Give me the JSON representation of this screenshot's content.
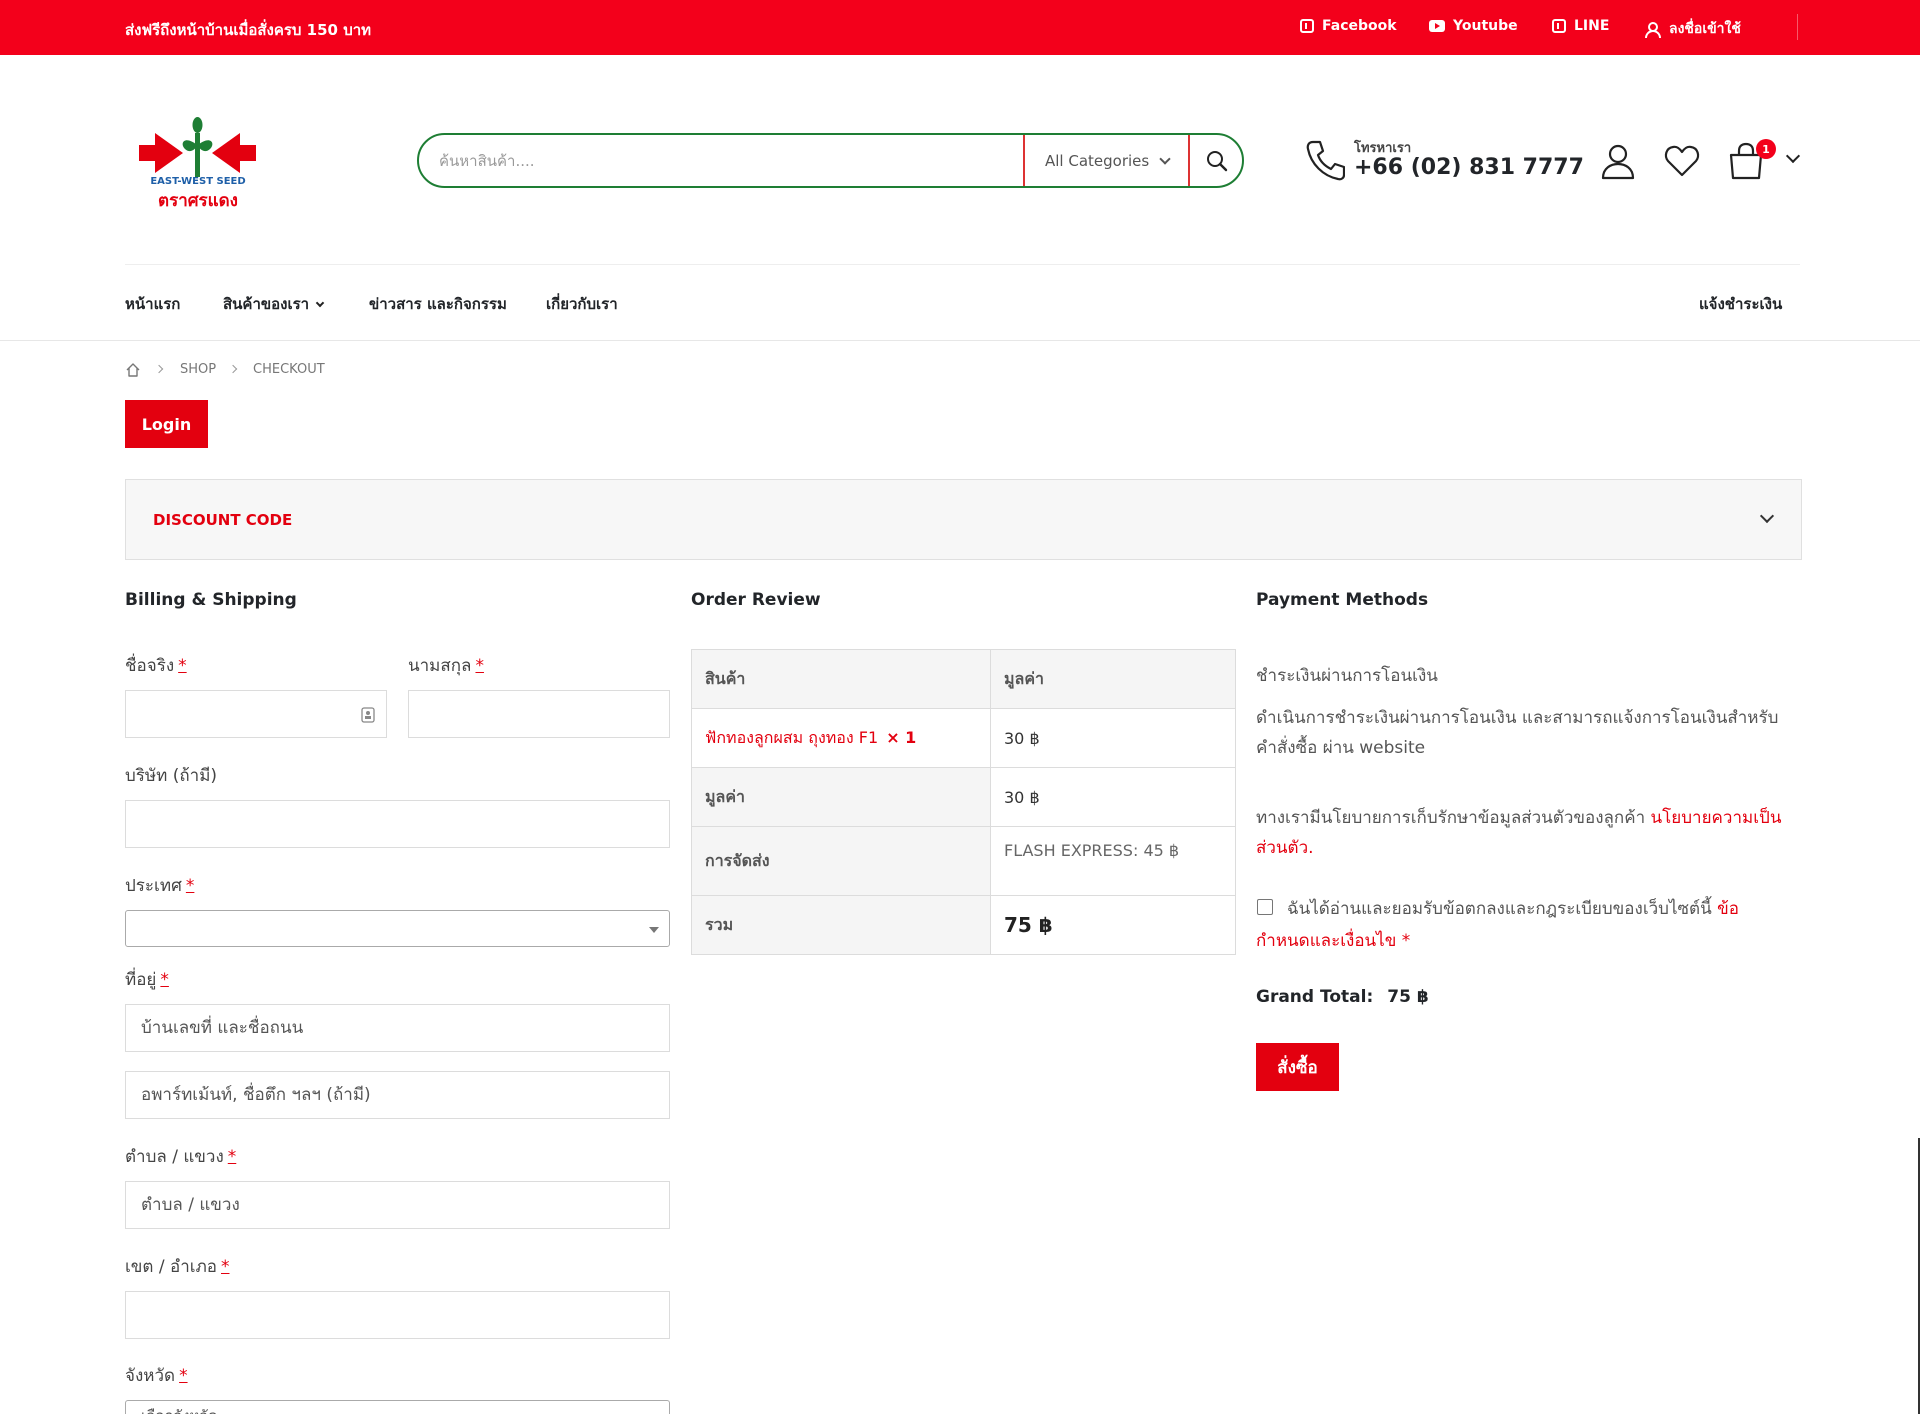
{
  "topbar": {
    "promo": "ส่งฟรีถึงหน้าบ้านเมื่อสั่งครบ 150 บาท",
    "facebook": "Facebook",
    "youtube": "Youtube",
    "line": "LINE",
    "login": "ลงชื่อเข้าใช้",
    "bg_color": "#f3001b"
  },
  "header": {
    "logo_text": "EAST-WEST SEED",
    "logo_thai": "ตราศรแดง",
    "search_placeholder": "ค้นหาสินค้า....",
    "category": "All Categories",
    "phone_label": "โทรหาเรา",
    "phone_number": "+66 (02) 831 7777",
    "cart_count": "1"
  },
  "nav": {
    "home": "หน้าแรก",
    "products": "สินค้าของเรา",
    "news": "ข่าวสาร และกิจกรรม",
    "about": "เกี่ยวกับเรา",
    "payment_notice": "แจ้งชำระเงิน"
  },
  "breadcrumb": {
    "shop": "Shop",
    "checkout": "Checkout"
  },
  "login_button": "Login",
  "discount_label": "DISCOUNT CODE",
  "sections": {
    "billing": "Billing & Shipping",
    "review": "Order Review",
    "payment": "Payment Methods"
  },
  "form": {
    "first_name": "ชื่อจริง",
    "last_name": "นามสกุล",
    "company": "บริษัท (ถ้ามี)",
    "country": "ประเทศ",
    "address": "ที่อยู่",
    "address1_placeholder": "บ้านเลขที่ และชื่อถนน",
    "address2_placeholder": "อพาร์ทเม้นท์, ชื่อตึก ฯลฯ (ถ้ามี)",
    "subdistrict": "ตำบล / แขวง",
    "subdistrict_placeholder": "ตำบล / แขวง",
    "district": "เขต / อำเภอ",
    "province": "จังหวัด",
    "province_placeholder": "เลือกจังหวัด",
    "req": "*"
  },
  "order": {
    "head_product": "สินค้า",
    "head_value": "มูลค่า",
    "product_name": "ฟักทองลูกผสม ถุงทอง F1",
    "product_qty": "× 1",
    "product_price": "30 ฿",
    "subtotal_label": "มูลค่า",
    "subtotal": "30 ฿",
    "shipping_label": "การจัดส่ง",
    "shipping": "FLASH EXPRESS: 45 ฿",
    "total_label": "รวม",
    "total": "75 ฿"
  },
  "payment": {
    "method": "ชำระเงินผ่านการโอนเงิน",
    "desc": "ดำเนินการชำระเงินผ่านการโอนเงิน และสามารถแจ้งการโอนเงินสำหรับคำสั่งซื้อ ผ่าน website",
    "privacy_text": "ทางเรามีนโยบายการเก็บรักษาข้อมูลส่วนตัวของลูกค้า",
    "privacy_link": "นโยบายความเป็นส่วนตัว",
    "privacy_end": ".",
    "terms_text": "ฉันได้อ่านและยอมรับข้อตกลงและกฎระเบียบของเว็บไซต์นี้",
    "terms_link": "ข้อกำหนดและเงื่อนไข",
    "terms_req": "*",
    "grand_label": "Grand Total:",
    "grand_value": "75 ฿",
    "order_button": "สั่งซื้อ"
  }
}
